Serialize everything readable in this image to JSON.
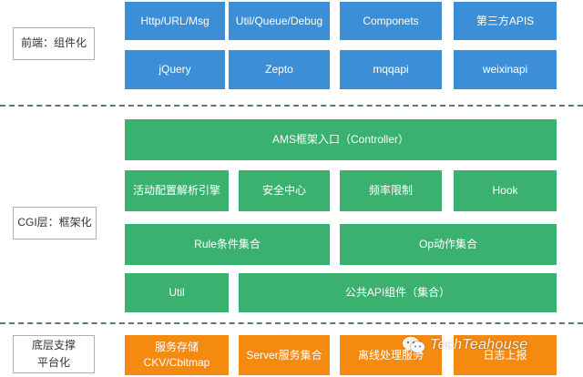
{
  "frontend": {
    "label": "前端：组件化",
    "row1": [
      "Http/URL/Msg",
      "Util/Queue/Debug",
      "Componets",
      "第三方APIS"
    ],
    "row2": [
      "jQuery",
      "Zepto",
      "mqqapi",
      "weixinapi"
    ]
  },
  "cgi": {
    "label": "CGI层：框架化",
    "entry": "AMS框架入口（Controller）",
    "row2": [
      "活动配置解析引擎",
      "安全中心",
      "频率限制",
      "Hook"
    ],
    "row3": [
      "Rule条件集合",
      "Op动作集合"
    ],
    "row4": [
      "Util",
      "公共API组件（集合）"
    ]
  },
  "platform": {
    "label_line1": "底层支撑",
    "label_line2": "平台化",
    "box1_line1": "服务存储",
    "box1_line2": "CKV/Cbitmap",
    "box2": "Server服务集合",
    "box3": "离线处理服务",
    "box4": "日志上报"
  },
  "watermark": {
    "text": "TechTeahouse"
  },
  "colors": {
    "frontend_box": "#3c8fd6",
    "cgi_box": "#3bb16f",
    "platform_box": "#f58a10",
    "divider": "#5b7587"
  }
}
